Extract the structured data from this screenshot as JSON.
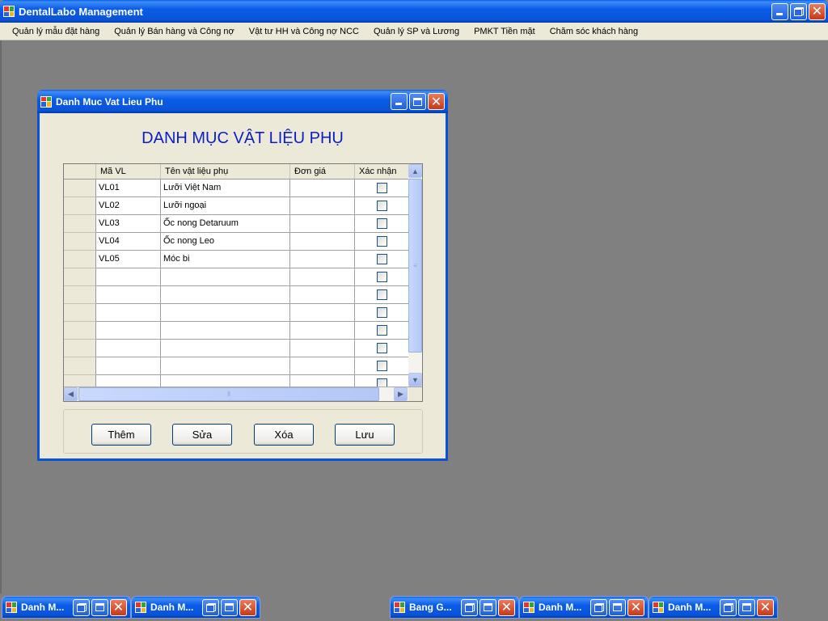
{
  "app": {
    "title": "DentalLabo Management"
  },
  "menu": [
    "Quản lý mẫu đặt hàng",
    "Quản lý Bán hàng và Công nợ",
    "Vật tư HH và Công nợ NCC",
    "Quản lý SP và Lương",
    "PMKT Tiền mặt",
    "Chăm sóc khách hàng"
  ],
  "form": {
    "title": "Danh Muc Vat Lieu Phu",
    "heading": "DANH MỤC VẬT LIỆU PHỤ",
    "columns": [
      "Mã VL",
      "Tên vật liệu phụ",
      "Đơn giá",
      "Xác nhận"
    ],
    "rows": [
      {
        "ma": "VL01",
        "ten": "Lưỡi Việt Nam",
        "dongia": "",
        "xacnhan": false
      },
      {
        "ma": "VL02",
        "ten": "Lưỡi ngoại",
        "dongia": "",
        "xacnhan": false
      },
      {
        "ma": "VL03",
        "ten": "Ốc nong Detaruum",
        "dongia": "",
        "xacnhan": false
      },
      {
        "ma": "VL04",
        "ten": "Ốc nong Leo",
        "dongia": "",
        "xacnhan": false
      },
      {
        "ma": "VL05",
        "ten": "Móc bi",
        "dongia": "",
        "xacnhan": false
      },
      {
        "ma": "",
        "ten": "",
        "dongia": "",
        "xacnhan": false
      },
      {
        "ma": "",
        "ten": "",
        "dongia": "",
        "xacnhan": false
      },
      {
        "ma": "",
        "ten": "",
        "dongia": "",
        "xacnhan": false
      },
      {
        "ma": "",
        "ten": "",
        "dongia": "",
        "xacnhan": false
      },
      {
        "ma": "",
        "ten": "",
        "dongia": "",
        "xacnhan": false
      },
      {
        "ma": "",
        "ten": "",
        "dongia": "",
        "xacnhan": false
      },
      {
        "ma": "",
        "ten": "",
        "dongia": "",
        "xacnhan": false
      }
    ],
    "buttons": {
      "add": "Thêm",
      "edit": "Sửa",
      "delete": "Xóa",
      "save": "Lưu"
    }
  },
  "minimized_windows": [
    "Danh M...",
    "Danh M...",
    "Bang G...",
    "Danh M...",
    "Danh M..."
  ],
  "colors": {
    "titlebar": "#0a5ce8",
    "mdi_background": "#808080",
    "form_background": "#ece9d8",
    "heading": "#0a1ec8",
    "close_button": "#c6391a"
  },
  "icons": {
    "app": "windows-forms-icon",
    "minimize": "minimize-icon",
    "maximize": "maximize-icon",
    "restore": "restore-icon",
    "close": "close-icon"
  }
}
